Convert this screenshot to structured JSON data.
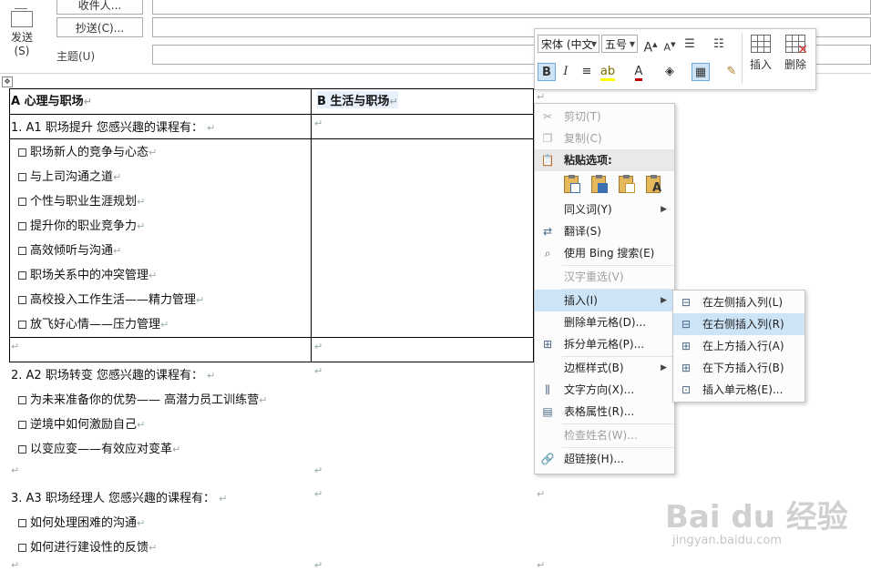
{
  "header": {
    "send_label_1": "发送",
    "send_label_2": "(S)",
    "to_button": "收件人...",
    "cc_button": "抄送(C)...",
    "subject_label": "主题(U)"
  },
  "doc": {
    "col_a_header": "A 心理与职场",
    "col_b_header": "B  生活与职场",
    "sec1_title": "1. A1  职场提升  您感兴趣的课程有：",
    "sec1_items": [
      "职场新人的竞争与心态",
      "与上司沟通之道",
      "个性与职业生涯规划",
      "提升你的职业竞争力",
      "高效倾听与沟通",
      "职场关系中的冲突管理",
      "高校投入工作生活——精力管理",
      "放飞好心情——压力管理"
    ],
    "sec2_title": "2. A2 职场转变  您感兴趣的课程有：",
    "sec2_items": [
      "为未来准备你的优势——  高潜力员工训练营",
      "逆境中如何激励自己",
      "以变应变——有效应对变革"
    ],
    "sec3_title": "3. A3  职场经理人  您感兴趣的课程有：",
    "sec3_items": [
      "如何处理困难的沟通",
      "如何进行建设性的反馈"
    ],
    "para_mark": "↵",
    "cell_mark": "↵"
  },
  "mini_toolbar": {
    "font_name": "宋体 (中文",
    "font_size": "五号",
    "insert_label": "插入",
    "delete_label": "删除",
    "bold": "B",
    "italic": "I"
  },
  "context_menu": {
    "cut": "剪切(T)",
    "copy": "复制(C)",
    "paste_options": "粘贴选项:",
    "synonym": "同义词(Y)",
    "translate": "翻译(S)",
    "bing_search": "使用 Bing 搜索(E)",
    "hanzi_reselect": "汉字重选(V)",
    "insert": "插入(I)",
    "delete_cells": "删除单元格(D)...",
    "split_cells": "拆分单元格(P)...",
    "border_style": "边框样式(B)",
    "text_direction": "文字方向(X)...",
    "table_properties": "表格属性(R)...",
    "check_name": "检查姓名(W)...",
    "hyperlink": "超链接(H)..."
  },
  "submenu": {
    "insert_left": "在左侧插入列(L)",
    "insert_right": "在右侧插入列(R)",
    "insert_above": "在上方插入行(A)",
    "insert_below": "在下方插入行(B)",
    "insert_cells": "插入单元格(E)..."
  },
  "watermark": {
    "brand": "Bai du 经验",
    "url": "jingyan.baidu.com"
  },
  "colors": {
    "highlight": "#cde4f7",
    "accent_border": "#6fa8dc"
  }
}
